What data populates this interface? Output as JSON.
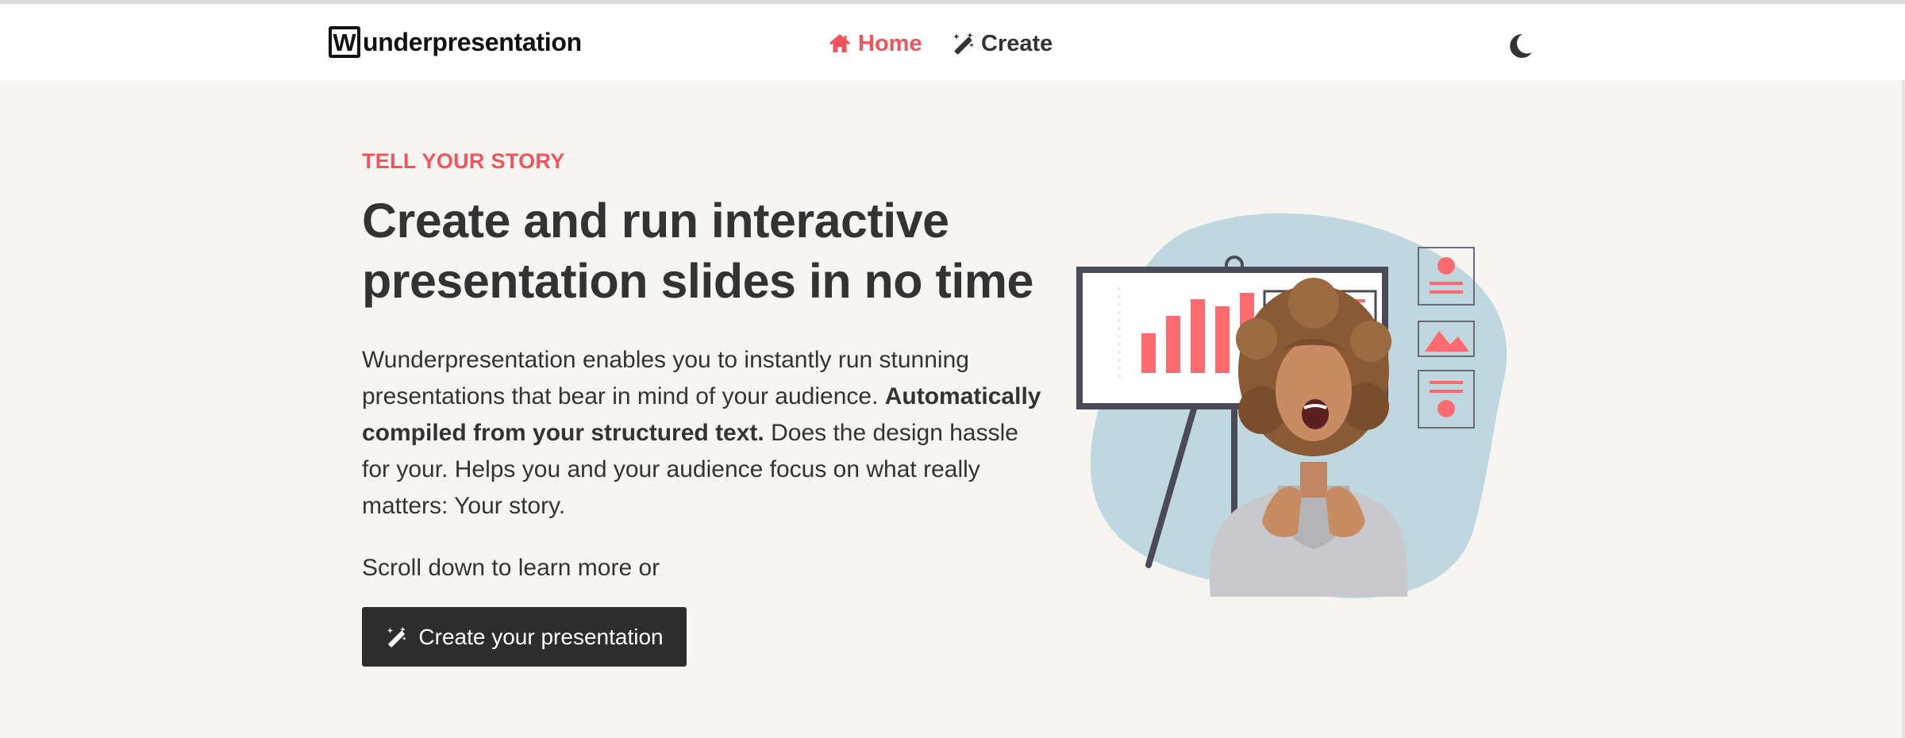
{
  "brand": {
    "initial": "W",
    "rest": "underpresentation"
  },
  "nav": {
    "home_label": "Home",
    "create_label": "Create"
  },
  "hero": {
    "eyebrow": "TELL YOUR STORY",
    "headline": "Create and run interactive presentation slides in no time",
    "lead_intro": "Wunderpresentation enables you to instantly run stunning presentations that bear in mind of your audience.",
    "lead_bold": "Automatically compiled from your structured text.",
    "lead_outro": "Does the design hassle for your. Helps you and your audience focus on what really matters: Your story.",
    "scroll_text": "Scroll down to learn more or",
    "cta_label": "Create your presentation"
  },
  "icons": {
    "home": "home-icon",
    "create": "magic-wand-icon",
    "theme": "moon-icon",
    "cta": "magic-wand-icon"
  },
  "colors": {
    "accent": "#f2545b",
    "text": "#333333",
    "background": "#f6f5f2",
    "navbar": "#ffffff",
    "button": "#2d2d2d",
    "illustration_blob": "#bfd8df"
  }
}
